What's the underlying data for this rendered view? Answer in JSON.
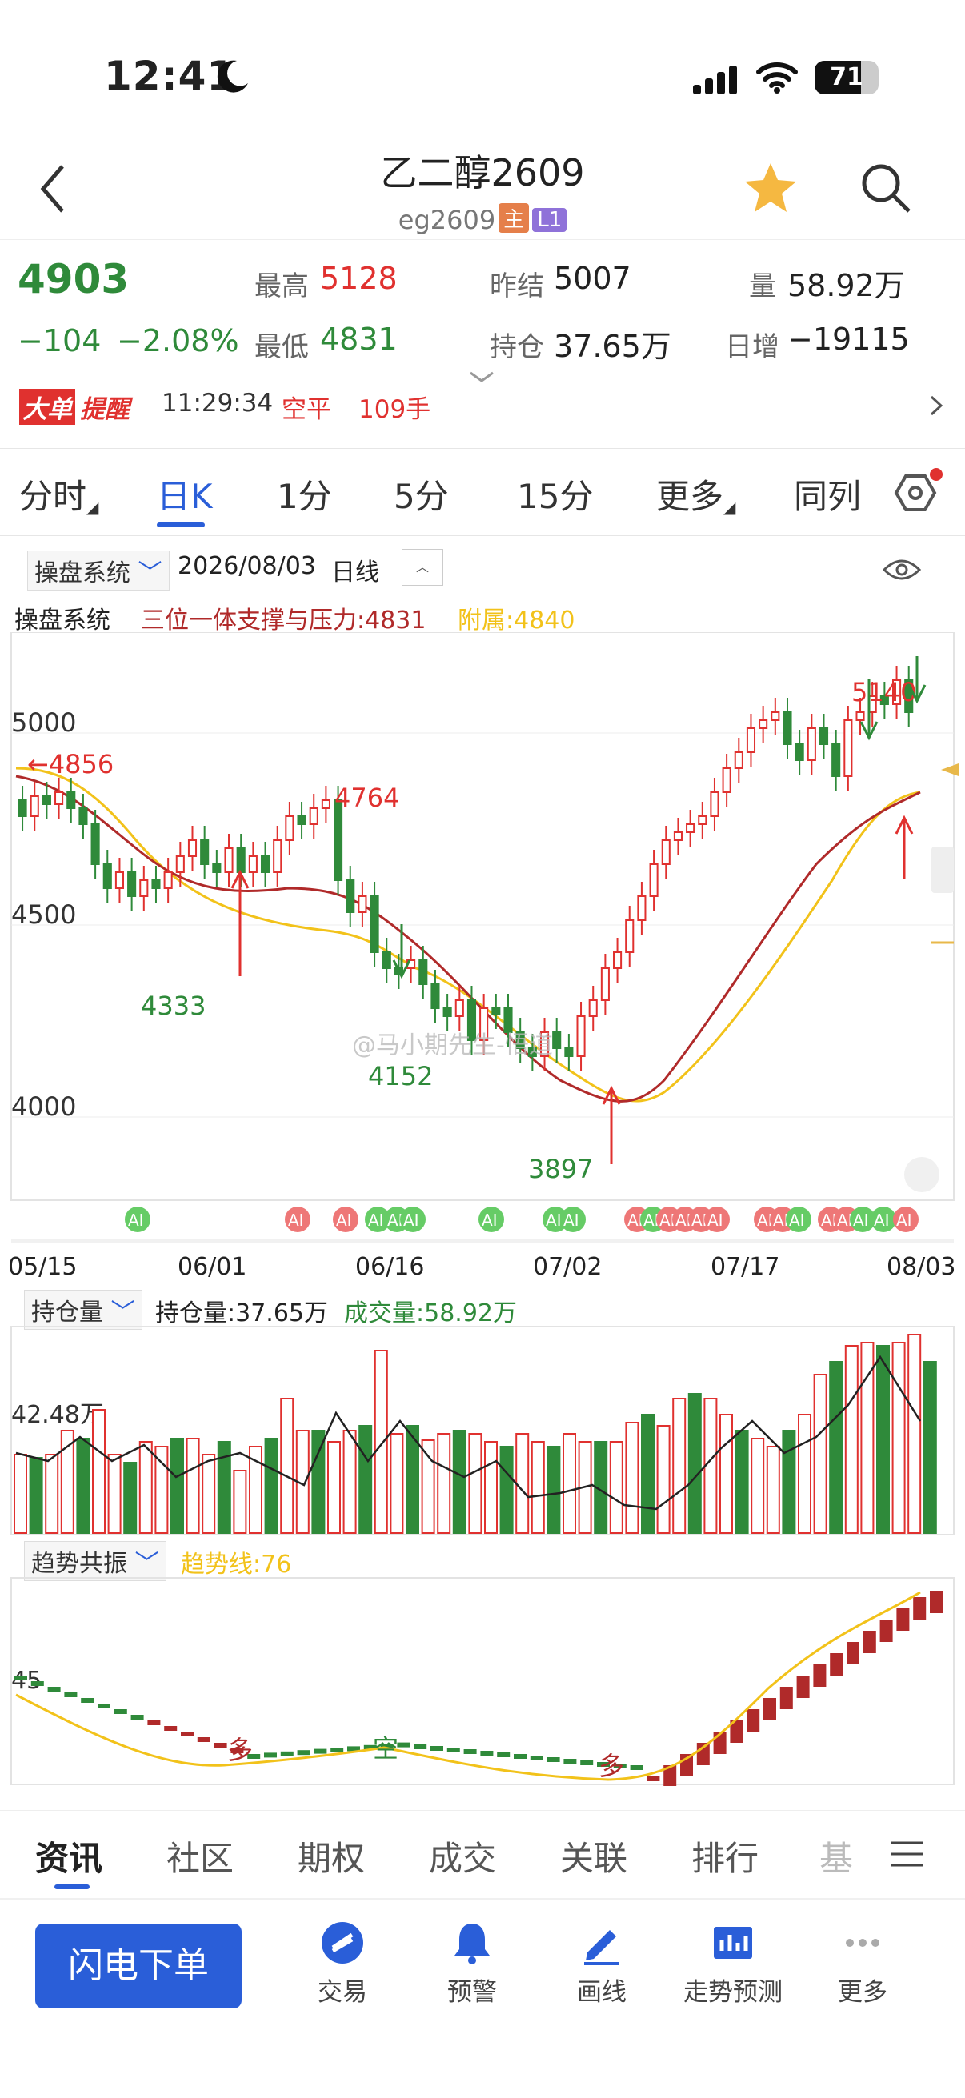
{
  "status_bar": {
    "time": "12:41",
    "battery": "71"
  },
  "header": {
    "title": "乙二醇2609",
    "code": "eg2609",
    "tag_main": "主",
    "tag_level": "L1"
  },
  "quote": {
    "price": "4903",
    "change": "−104",
    "change_pct": "−2.08%",
    "high_label": "最高",
    "high": "5128",
    "low_label": "最低",
    "low": "4831",
    "prev_label": "昨结",
    "prev": "5007",
    "oi_label": "持仓",
    "oi": "37.65万",
    "vol_label": "量",
    "vol": "58.92万",
    "daily_inc_label": "日增",
    "daily_inc": "−19115"
  },
  "big_order": {
    "badge_1": "大单",
    "badge_2": "提醒",
    "time": "11:29:34",
    "type": "空平",
    "lots": "109手"
  },
  "tabs": [
    "分时",
    "日K",
    "1分",
    "5分",
    "15分",
    "更多",
    "同列"
  ],
  "active_tab": "日K",
  "indicator": {
    "system_select": "操盘系统",
    "date": "2026/08/03",
    "period": "日线",
    "line_name": "操盘系统",
    "line_label": "三位一体支撑与压力:4831",
    "attach_label": "附属:4840"
  },
  "colors": {
    "up": "#e0312f",
    "down": "#2f8a3a",
    "accent": "#2a5ed8",
    "ma_yellow": "#f2c21a",
    "ma_red": "#b02a2a"
  },
  "chart_data": {
    "type": "candlestick",
    "y_ticks": [
      "5000",
      "4500",
      "4000"
    ],
    "x_ticks": [
      "05/15",
      "06/01",
      "06/16",
      "07/02",
      "07/17",
      "08/03"
    ],
    "annotations": {
      "left_arrow_label": "←4856",
      "high1": "4764",
      "low1": "4333",
      "low2": "4152",
      "low3": "3897",
      "high2": "5140"
    },
    "watermark": "@马小期先生-悟道",
    "ai_badge": "AI"
  },
  "oi_panel": {
    "select": "持仓量",
    "oi_label": "持仓量:37.65万",
    "vol_label": "成交量:58.92万",
    "axis_label": "42.48万"
  },
  "trend_panel": {
    "select": "趋势共振",
    "trend_label": "趋势线:76",
    "axis_label": "45",
    "labels": [
      "多",
      "空",
      "多"
    ]
  },
  "bottom_tabs": [
    "资讯",
    "社区",
    "期权",
    "成交",
    "关联",
    "排行",
    "基"
  ],
  "toolbar": {
    "flash_order": "闪电下单",
    "items": [
      "交易",
      "预警",
      "画线",
      "走势预测",
      "更多"
    ]
  }
}
